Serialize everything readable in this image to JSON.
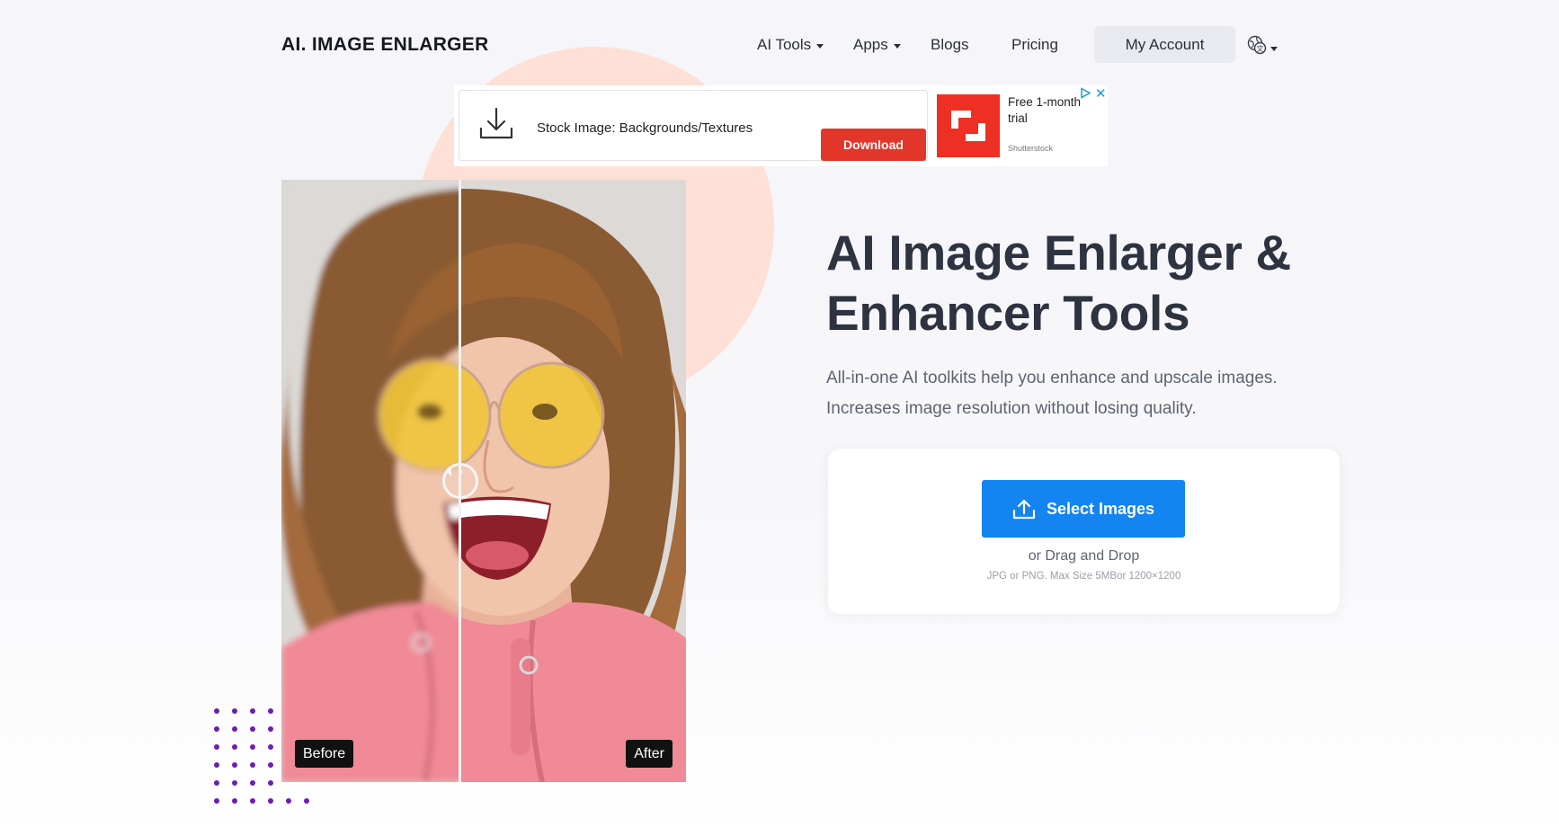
{
  "brand": {
    "logo_text": "AI. IMAGE ENLARGER"
  },
  "nav": {
    "items": [
      {
        "label": "AI Tools",
        "has_dropdown": true
      },
      {
        "label": "Apps",
        "has_dropdown": true
      },
      {
        "label": "Blogs",
        "has_dropdown": false
      },
      {
        "label": "Pricing",
        "has_dropdown": false
      }
    ],
    "account_label": "My Account",
    "language_icon": "language-icon"
  },
  "ad": {
    "title": "Stock Image: Backgrounds/Textures",
    "cta": "Download",
    "offer": "Free 1-month trial",
    "brand": "Shutterstock",
    "choices_icon": "ad-choices-icon",
    "close_icon": "close-icon"
  },
  "compare": {
    "before_label": "Before",
    "after_label": "After",
    "handle_icon": "drag-handle-icon"
  },
  "hero": {
    "title": "AI Image Enlarger & Enhancer Tools",
    "subtitle": "All-in-one AI toolkits help you enhance and upscale images. Increases image resolution without losing quality."
  },
  "upload": {
    "button_label": "Select Images",
    "button_icon": "upload-icon",
    "drag_text": "or Drag and Drop",
    "hint": "JPG or PNG. Max Size 5MBor 1200×1200"
  },
  "colors": {
    "accent": "#1384f0",
    "ad_red": "#e3362a",
    "peach": "#ffdcd0",
    "dots": "#6a1fb3"
  }
}
